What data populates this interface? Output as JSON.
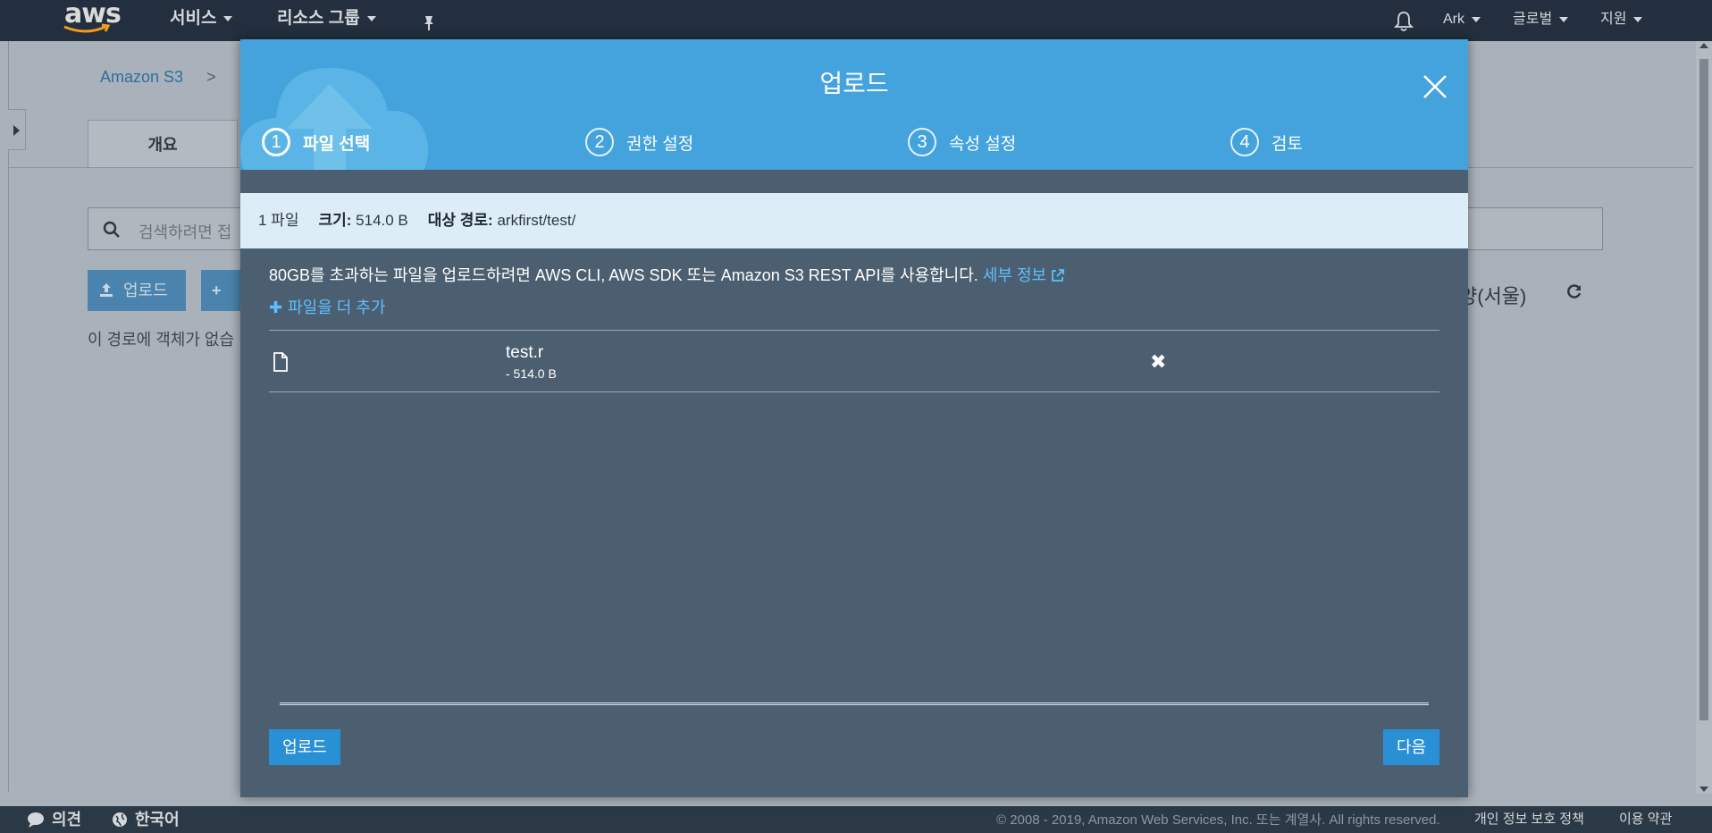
{
  "topnav": {
    "logo": "aws",
    "services": "서비스",
    "resource_groups": "리소스 그룹",
    "account": "Ark",
    "region": "글로벌",
    "support": "지원"
  },
  "background": {
    "breadcrumb": "Amazon S3",
    "breadcrumb_sep": ">",
    "tab_overview": "개요",
    "search_placeholder": "검색하려면 접",
    "upload_button": "업로드",
    "create_button": "+",
    "region_text": "양(서울)",
    "empty_text": "이 경로에 객체가 없습"
  },
  "modal": {
    "title": "업로드",
    "steps": [
      {
        "num": "1",
        "label": "파일 선택"
      },
      {
        "num": "2",
        "label": "권한 설정"
      },
      {
        "num": "3",
        "label": "속성 설정"
      },
      {
        "num": "4",
        "label": "검토"
      }
    ],
    "info": {
      "count": "1 파일",
      "size_label": "크기:",
      "size_value": "514.0 B",
      "target_label": "대상 경로:",
      "target_value": "arkfirst/test/"
    },
    "note": "80GB를 초과하는 파일을 업로드하려면 AWS CLI, AWS SDK 또는 Amazon S3 REST API를 사용합니다.",
    "note_link": "세부 정보",
    "add_more": "파일을 더 추가",
    "files": [
      {
        "name": "test.r",
        "size": "- 514.0 B"
      }
    ],
    "upload_button": "업로드",
    "next_button": "다음"
  },
  "footer": {
    "feedback": "의견",
    "language": "한국어",
    "copyright": "© 2008 - 2019, Amazon Web Services, Inc. 또는 계열사. All rights reserved.",
    "privacy": "개인 정보 보호 정책",
    "terms": "이용 약관"
  },
  "colors": {
    "nav_bg": "#232f3e",
    "modal_header": "#44a3dd",
    "modal_body": "#4c5f71",
    "info_bar": "#dcedf8",
    "link": "#5cc0ff",
    "button": "#2a90d6"
  }
}
